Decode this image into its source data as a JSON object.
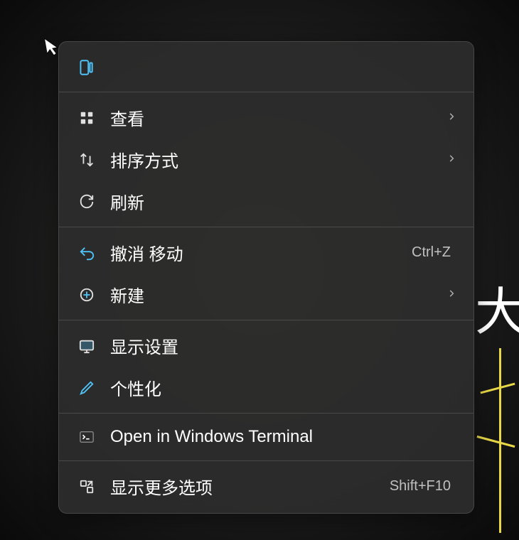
{
  "menu": {
    "items": [
      {
        "label": "查看",
        "icon": "grid-icon",
        "has_submenu": true
      },
      {
        "label": "排序方式",
        "icon": "sort-icon",
        "has_submenu": true
      },
      {
        "label": "刷新",
        "icon": "refresh-icon"
      },
      {
        "divider": true
      },
      {
        "label": "撤消 移动",
        "icon": "undo-icon",
        "shortcut": "Ctrl+Z"
      },
      {
        "label": "新建",
        "icon": "new-icon",
        "has_submenu": true
      },
      {
        "divider": true
      },
      {
        "label": "显示设置",
        "icon": "display-icon"
      },
      {
        "label": "个性化",
        "icon": "personalize-icon"
      },
      {
        "divider": true
      },
      {
        "label": "Open in Windows Terminal",
        "icon": "terminal-icon"
      },
      {
        "divider": true
      },
      {
        "label": "显示更多选项",
        "icon": "more-icon",
        "shortcut": "Shift+F10"
      }
    ]
  },
  "background_text": "大"
}
